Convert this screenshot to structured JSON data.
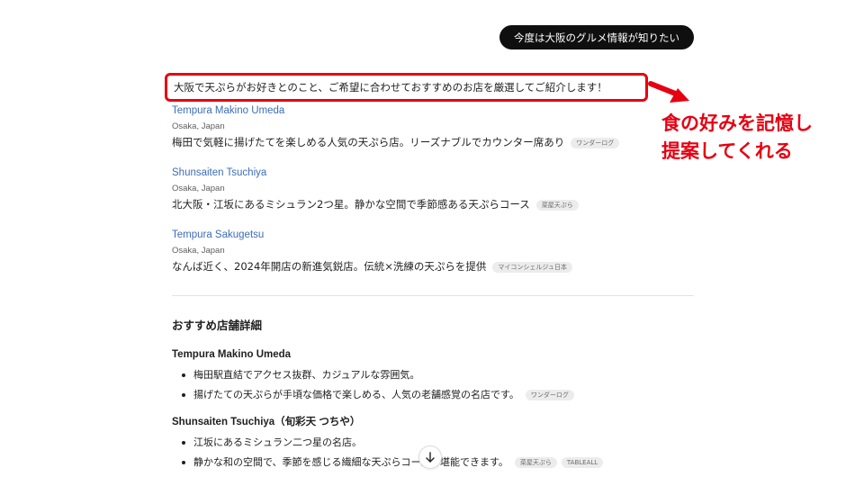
{
  "user_message": "今度は大阪のグルメ情報が知りたい",
  "assistant_intro": "大阪で天ぷらがお好きとのこと、ご希望に合わせておすすめのお店を厳選してご紹介します！",
  "annotation": {
    "line1": "食の好みを記憶し",
    "line2": "提案してくれる",
    "color": "#e60012"
  },
  "results": [
    {
      "name": "Tempura Makino Umeda",
      "location": "Osaka, Japan",
      "description": "梅田で気軽に揚げたてを楽しめる人気の天ぷら店。リーズナブルでカウンター席あり",
      "source": "ワンダーログ"
    },
    {
      "name": "Shunsaiten Tsuchiya",
      "location": "Osaka, Japan",
      "description": "北大阪・江坂にあるミシュラン2つ星。静かな空間で季節感ある天ぷらコース",
      "source": "菜屋天ぷら"
    },
    {
      "name": "Tempura Sakugetsu",
      "location": "Osaka, Japan",
      "description": "なんば近く、2024年開店の新進気鋭店。伝統×洗練の天ぷらを提供",
      "source": "マイコンシェルジュ日本"
    }
  ],
  "details": {
    "title": "おすすめ店舗詳細",
    "stores": [
      {
        "name": "Tempura Makino Umeda",
        "bullets": [
          {
            "text": "梅田駅直結でアクセス抜群、カジュアルな雰囲気。",
            "sources": []
          },
          {
            "text": "揚げたての天ぷらが手頃な価格で楽しめる、人気の老舗感覚の名店です。",
            "sources": [
              "ワンダーログ"
            ]
          }
        ]
      },
      {
        "name": "Shunsaiten Tsuchiya（旬彩天 つちや）",
        "bullets": [
          {
            "text": "江坂にあるミシュラン二つ星の名店。",
            "sources": []
          },
          {
            "text": "静かな和の空間で、季節を感じる繊細な天ぷらコースを堪能できます。",
            "sources": [
              "菜屋天ぷら",
              "TABLEALL"
            ]
          }
        ]
      }
    ]
  },
  "icons": {
    "annotation_arrow": "arrow-icon",
    "scroll_down": "arrow-down-icon"
  },
  "colors": {
    "link": "#3c6db8",
    "user_bubble_bg": "#0f0f0f",
    "highlight_border": "#e60012"
  }
}
